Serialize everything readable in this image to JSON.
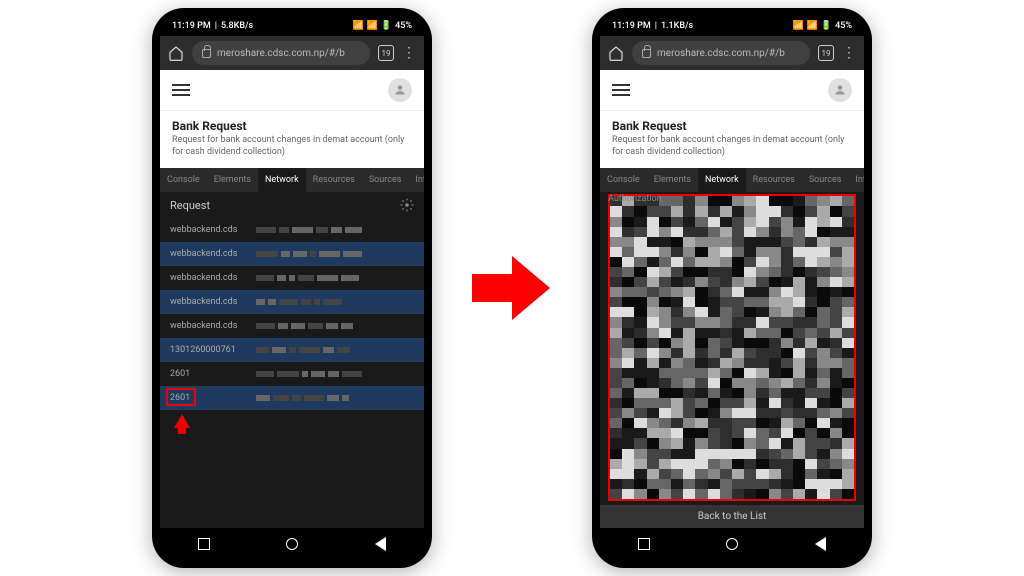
{
  "status": {
    "time": "11:19 PM",
    "net1": "5.8KB/s",
    "net2": "1.1KB/s",
    "battery": "45%"
  },
  "browser": {
    "url": "meroshare.cdsc.com.np/#/b",
    "tabs": "19"
  },
  "page": {
    "title": "Bank Request",
    "subtitle": "Request for bank account changes in demat account (only for cash dividend collection)"
  },
  "devtools": {
    "tabs": [
      "Console",
      "Elements",
      "Network",
      "Resources",
      "Sources",
      "Info"
    ],
    "active": "Network",
    "request_label": "Request",
    "auth_label": "Authorization",
    "back_label": "Back to the List"
  },
  "requests": [
    {
      "name": "webbackend.cds",
      "sel": false
    },
    {
      "name": "webbackend.cds",
      "sel": true
    },
    {
      "name": "webbackend.cds",
      "sel": false
    },
    {
      "name": "webbackend.cds",
      "sel": true
    },
    {
      "name": "webbackend.cds",
      "sel": false
    },
    {
      "name": "1301260000761",
      "sel": true
    },
    {
      "name": "2601",
      "sel": false
    },
    {
      "name": "2601",
      "sel": true,
      "hl": true
    }
  ]
}
